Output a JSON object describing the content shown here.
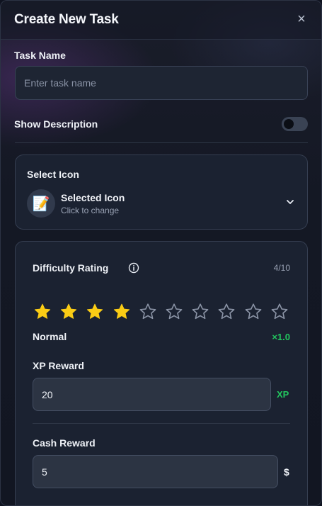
{
  "dialog": {
    "title": "Create New Task",
    "close_symbol": "×"
  },
  "task_name": {
    "label": "Task Name",
    "placeholder": "Enter task name",
    "value": ""
  },
  "description": {
    "label": "Show Description",
    "enabled": false
  },
  "icon_select": {
    "label": "Select Icon",
    "selected_icon": "📝",
    "title": "Selected Icon",
    "subtitle": "Click to change"
  },
  "difficulty": {
    "label": "Difficulty Rating",
    "count_text": "4/10",
    "rating": 4,
    "max": 10,
    "level_name": "Normal",
    "multiplier": "×1.0",
    "colors": {
      "filled": "#facc15",
      "empty": "#8b94a6"
    }
  },
  "xp_reward": {
    "label": "XP Reward",
    "value": "20",
    "suffix": "XP"
  },
  "cash_reward": {
    "label": "Cash Reward",
    "value": "5",
    "suffix": "$"
  },
  "colors": {
    "accent_green": "#22c55e",
    "star_yellow": "#facc15"
  }
}
